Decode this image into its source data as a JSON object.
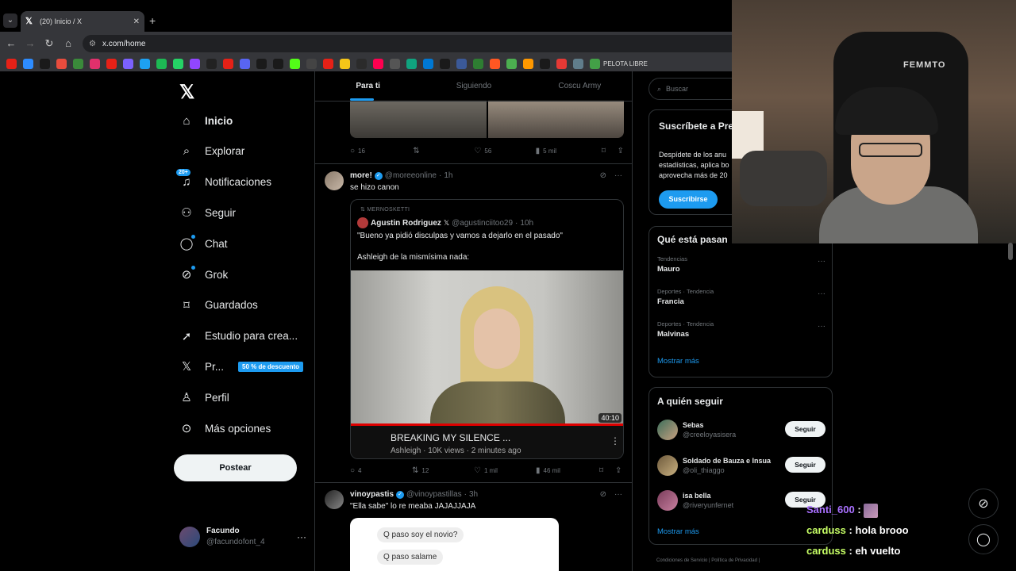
{
  "browser": {
    "tab_title": "(20) Inicio / X",
    "url": "x.com/home",
    "bookmarks_label": "PELOTA LIBRE",
    "bookmark_colors": [
      "#e62117",
      "#2d8cff",
      "#1a1a1a",
      "#e84c3d",
      "#3a8a3a",
      "#e1306c",
      "#e62117",
      "#7b61ff",
      "#1da1f2",
      "#1db954",
      "#25d366",
      "#9146ff",
      "#222222",
      "#e62117",
      "#5865f2",
      "#1a1a1a",
      "#1a1a1a",
      "#53fc18",
      "#444444",
      "#e62117",
      "#f5c518",
      "#2b2b2b",
      "#ff0050",
      "#555555",
      "#10a37f",
      "#0078d4",
      "#1a1a1a",
      "#3b5998",
      "#2e7d32",
      "#ff5722",
      "#4caf50",
      "#ff9800",
      "#1a1a1a",
      "#e53935",
      "#607d8b",
      "#43a047"
    ]
  },
  "sidebar": {
    "nav": [
      {
        "label": "Inicio",
        "icon": "home-icon"
      },
      {
        "label": "Explorar",
        "icon": "search-icon"
      },
      {
        "label": "Notificaciones",
        "icon": "bell-icon",
        "badge": "20+"
      },
      {
        "label": "Seguir",
        "icon": "person-add-icon"
      },
      {
        "label": "Chat",
        "icon": "chat-icon"
      },
      {
        "label": "Grok",
        "icon": "grok-icon"
      },
      {
        "label": "Guardados",
        "icon": "bookmark-icon"
      },
      {
        "label": "Estudio para crea...",
        "icon": "rocket-icon"
      },
      {
        "label": "Pr...",
        "icon": "x-icon",
        "discount": "50 % de descuento"
      },
      {
        "label": "Perfil",
        "icon": "person-icon"
      },
      {
        "label": "Más opciones",
        "icon": "more-circle-icon"
      }
    ],
    "post_label": "Postear",
    "profile": {
      "name": "Facundo",
      "handle": "@facundofont_4"
    }
  },
  "feed": {
    "tabs": [
      "Para ti",
      "Siguiendo",
      "Coscu Army"
    ],
    "prev_tweet_stats": {
      "replies": "16",
      "likes": "56",
      "views": "5 mil"
    },
    "tweet1": {
      "name": "more!",
      "handle": "@moreeonline",
      "time": "1h",
      "text": "se hizo canon",
      "quote": {
        "reposter": "MERNOSKETTI",
        "name": "Agustin Rodriguez",
        "handle": "@agustinciitoo29",
        "time": "10h",
        "line1": "\"Bueno ya pidió disculpas y vamos a dejarlo en el pasado\"",
        "line2": "Ashleigh de la mismísima nada:",
        "video_duration": "40:10",
        "video_title": "BREAKING MY SILENCE ...",
        "video_sub": "Ashleigh · 10K views · 2 minutes ago"
      },
      "stats": {
        "replies": "4",
        "reposts": "12",
        "likes": "1 mil",
        "views": "46 mil"
      }
    },
    "tweet2": {
      "name": "vinoypastis",
      "handle": "@vinoypastillas",
      "time": "3h",
      "text": "\"Ella sabe\" lo re meaba JAJAJJAJA",
      "bubble1": "Q paso soy el novio?",
      "bubble2": "Q paso salame"
    }
  },
  "right": {
    "search_placeholder": "Buscar",
    "premium": {
      "title": "Suscríbete a Premium",
      "desc": "Despídete de los anu estadísticas, aplica bo aprovecha más de 20",
      "button": "Suscribirse"
    },
    "trends": {
      "title": "Qué está pasan",
      "items": [
        {
          "category": "Tendencias",
          "name": "Mauro"
        },
        {
          "category": "Deportes · Tendencia",
          "name": "Francia"
        },
        {
          "category": "Deportes · Tendencia",
          "name": "Malvinas"
        }
      ],
      "more": "Mostrar más"
    },
    "follow": {
      "title": "A quién seguir",
      "items": [
        {
          "name": "Sebas",
          "handle": "@creeloyasisera",
          "button": "Seguir"
        },
        {
          "name": "Soldado de Bauza e Insua",
          "handle": "@oli_thiaggo",
          "button": "Seguir"
        },
        {
          "name": "isa bella",
          "handle": "@riveryunfernet",
          "button": "Seguir"
        }
      ],
      "more": "Mostrar más"
    },
    "footer": "Condiciones de Servicio  |  Política de Privacidad  |"
  },
  "webcam": {
    "brand": "FEMMTO"
  },
  "stream_chat": [
    {
      "user": "Santi_600",
      "msg": ""
    },
    {
      "user": "carduss",
      "msg": "hola brooo"
    },
    {
      "user": "carduss",
      "msg": "eh vuelto"
    }
  ]
}
